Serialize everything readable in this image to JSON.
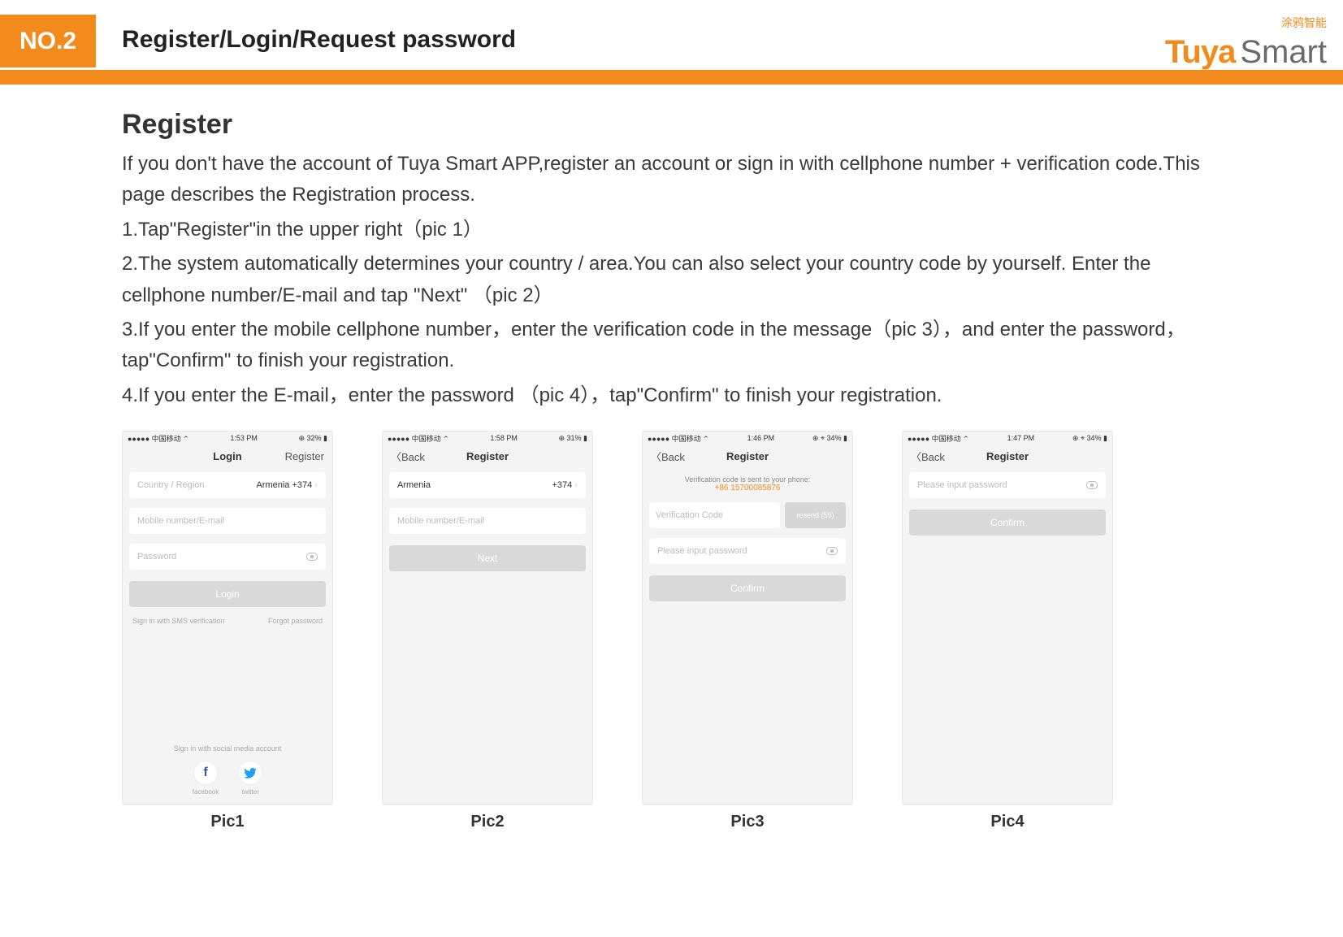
{
  "header": {
    "badge": "NO.2",
    "title": "Register/Login/Request password",
    "brand_cn": "涂鸦智能",
    "brand_main": "Tuya",
    "brand_sub": "Smart"
  },
  "content": {
    "section_title": "Register",
    "intro": "If you don't have the account of Tuya Smart APP,register an account or sign in with cellphone number + verification code.This page describes the Registration process.",
    "step1": "1.Tap\"Register\"in the upper right（pic 1）",
    "step2": "2.The system automatically determines your country / area.You can also select your country code by yourself. Enter the cellphone number/E-mail and tap \"Next\" （pic 2）",
    "step3": "3.If you enter the mobile cellphone number，enter the verification code in the message（pic 3），and enter the password，tap\"Confirm\" to finish your registration.",
    "step4": "4.If you enter the E-mail，enter the password （pic 4），tap\"Confirm\" to finish your registration."
  },
  "phones": {
    "p1": {
      "carrier": "●●●●● 中国移动 ⌃",
      "time": "1:53 PM",
      "battery": "⊕ 32% ▮",
      "nav_left": "",
      "nav_center": "Login",
      "nav_right": "Register",
      "country_label": "Country / Region",
      "country_value": "Armenia +374",
      "mobile_ph": "Mobile number/E-mail",
      "password_ph": "Password",
      "login_btn": "Login",
      "sms_link": "Sign in with SMS verification",
      "forgot_link": "Forgot password",
      "social_title": "Sign in with social media account",
      "facebook": "facebook",
      "twitter": "twitter"
    },
    "p2": {
      "carrier": "●●●●● 中国移动 ⌃",
      "time": "1:58 PM",
      "battery": "⊕ 31% ▮",
      "nav_left": "〈Back",
      "nav_center": "Register",
      "country_name": "Armenia",
      "country_code": "+374",
      "mobile_ph": "Mobile number/E-mail",
      "next_btn": "Next"
    },
    "p3": {
      "carrier": "●●●●● 中国移动 ⌃",
      "time": "1:46 PM",
      "battery": "⊕ ⌖ 34% ▮",
      "nav_left": "〈Back",
      "nav_center": "Register",
      "verif_text": "Verification code is sent to your phone:",
      "verif_num": "+86 15700085876",
      "code_ph": "Verification Code",
      "resend_label": "resend (59)",
      "password_ph": "Please input password",
      "confirm_btn": "Confirm"
    },
    "p4": {
      "carrier": "●●●●● 中国移动 ⌃",
      "time": "1:47 PM",
      "battery": "⊕ ⌖ 34% ▮",
      "nav_left": "〈Back",
      "nav_center": "Register",
      "password_ph": "Please input password",
      "confirm_btn": "Confirm"
    },
    "c1": "Pic1",
    "c2": "Pic2",
    "c3": "Pic3",
    "c4": "Pic4"
  }
}
